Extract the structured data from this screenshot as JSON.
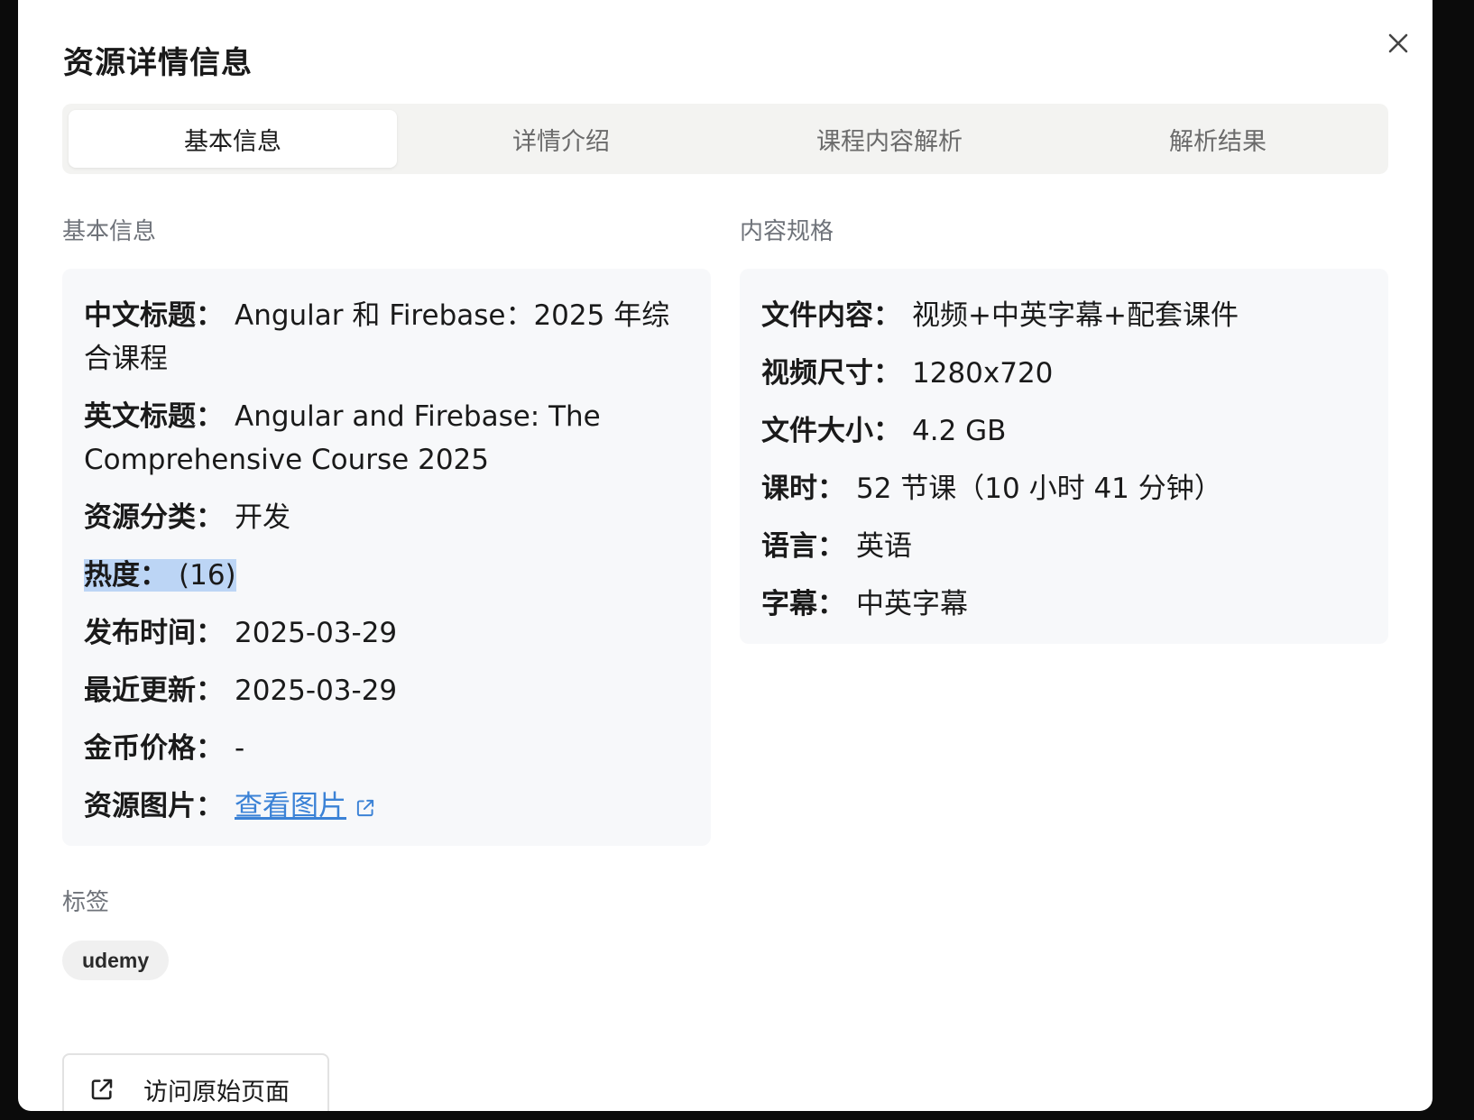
{
  "modal": {
    "title": "资源详情信息"
  },
  "tabs": [
    {
      "label": "基本信息",
      "active": true
    },
    {
      "label": "详情介绍",
      "active": false
    },
    {
      "label": "课程内容解析",
      "active": false
    },
    {
      "label": "解析结果",
      "active": false
    }
  ],
  "basic": {
    "heading": "基本信息",
    "cn_title_label": "中文标题：",
    "cn_title_value": "Angular 和 Firebase：2025 年综合课程",
    "en_title_label": "英文标题：",
    "en_title_value": "Angular and Firebase: The Comprehensive Course 2025",
    "category_label": "资源分类：",
    "category_value": "开发",
    "heat_label": "热度：",
    "heat_value": "(16)",
    "published_label": "发布时间：",
    "published_value": "2025-03-29",
    "updated_label": "最近更新：",
    "updated_value": "2025-03-29",
    "price_label": "金币价格：",
    "price_value": "-",
    "image_label": "资源图片：",
    "image_link": "查看图片"
  },
  "specs": {
    "heading": "内容规格",
    "content_label": "文件内容：",
    "content_value": "视频+中英字幕+配套课件",
    "resolution_label": "视频尺寸：",
    "resolution_value": "1280x720",
    "size_label": "文件大小：",
    "size_value": "4.2 GB",
    "lessons_label": "课时：",
    "lessons_value": "52 节课（10 小时 41 分钟）",
    "language_label": "语言：",
    "language_value": "英语",
    "subtitle_label": "字幕：",
    "subtitle_value": "中英字幕"
  },
  "tags": {
    "heading": "标签",
    "items": [
      "udemy"
    ]
  },
  "actions": {
    "visit_label": "访问原始页面"
  },
  "colors": {
    "accent_link": "#3b82d6",
    "highlight": "#bcd5f5"
  }
}
